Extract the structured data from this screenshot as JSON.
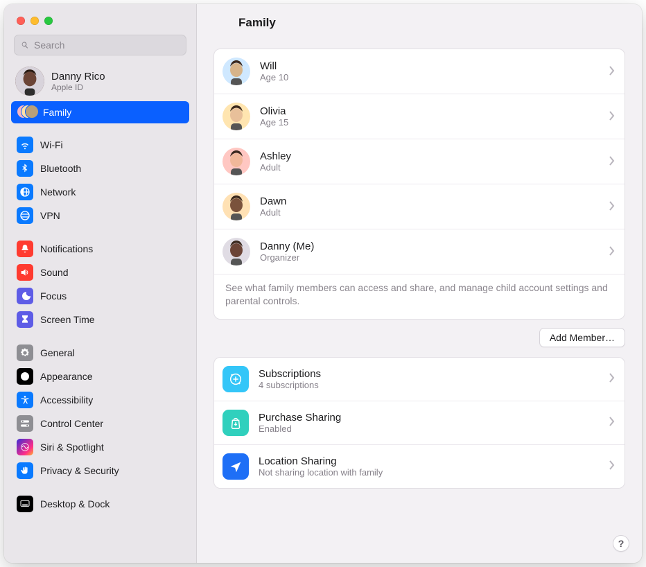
{
  "window": {
    "title": "Family"
  },
  "search": {
    "placeholder": "Search"
  },
  "profile": {
    "name": "Danny Rico",
    "sub": "Apple ID"
  },
  "sidebar": {
    "family_label": "Family",
    "items": [
      {
        "label": "Wi-Fi",
        "icon": "wifi-icon",
        "bg": "bg-blue"
      },
      {
        "label": "Bluetooth",
        "icon": "bluetooth-icon",
        "bg": "bg-bt"
      },
      {
        "label": "Network",
        "icon": "network-icon",
        "bg": "bg-blue"
      },
      {
        "label": "VPN",
        "icon": "vpn-icon",
        "bg": "bg-blue"
      }
    ],
    "items2": [
      {
        "label": "Notifications",
        "icon": "bell-icon",
        "bg": "bg-red"
      },
      {
        "label": "Sound",
        "icon": "speaker-icon",
        "bg": "bg-red"
      },
      {
        "label": "Focus",
        "icon": "moon-icon",
        "bg": "bg-indigo"
      },
      {
        "label": "Screen Time",
        "icon": "hourglass-icon",
        "bg": "bg-indigo"
      }
    ],
    "items3": [
      {
        "label": "General",
        "icon": "gear-icon",
        "bg": "bg-gray"
      },
      {
        "label": "Appearance",
        "icon": "appearance-icon",
        "bg": "bg-black"
      },
      {
        "label": "Accessibility",
        "icon": "accessibility-icon",
        "bg": "bg-blue"
      },
      {
        "label": "Control Center",
        "icon": "switches-icon",
        "bg": "bg-gray"
      },
      {
        "label": "Siri & Spotlight",
        "icon": "siri-icon",
        "bg": "bg-siri"
      },
      {
        "label": "Privacy & Security",
        "icon": "hand-icon",
        "bg": "bg-blue"
      }
    ],
    "items4": [
      {
        "label": "Desktop & Dock",
        "icon": "dock-icon",
        "bg": "bg-black"
      }
    ]
  },
  "members": [
    {
      "name": "Will",
      "sub": "Age 10",
      "avbg": "#cfe8ff",
      "face": "#d7b48a"
    },
    {
      "name": "Olivia",
      "sub": "Age 15",
      "avbg": "#ffe5b0",
      "face": "#e8c09a"
    },
    {
      "name": "Ashley",
      "sub": "Adult",
      "avbg": "#ffc7c2",
      "face": "#f1b89a"
    },
    {
      "name": "Dawn",
      "sub": "Adult",
      "avbg": "#ffe1b4",
      "face": "#7a523c"
    },
    {
      "name": "Danny (Me)",
      "sub": "Organizer",
      "avbg": "#e0dce4",
      "face": "#6b4436"
    }
  ],
  "members_footnote": "See what family members can access and share, and manage child account settings and parental controls.",
  "add_member_label": "Add Member…",
  "features": [
    {
      "name": "Subscriptions",
      "sub": "4 subscriptions",
      "icon": "subscriptions-icon",
      "bg": "bg-cyan"
    },
    {
      "name": "Purchase Sharing",
      "sub": "Enabled",
      "icon": "bag-icon",
      "bg": "bg-teal"
    },
    {
      "name": "Location Sharing",
      "sub": "Not sharing location with family",
      "icon": "location-icon",
      "bg": "bg-blue2"
    }
  ],
  "help_label": "?"
}
